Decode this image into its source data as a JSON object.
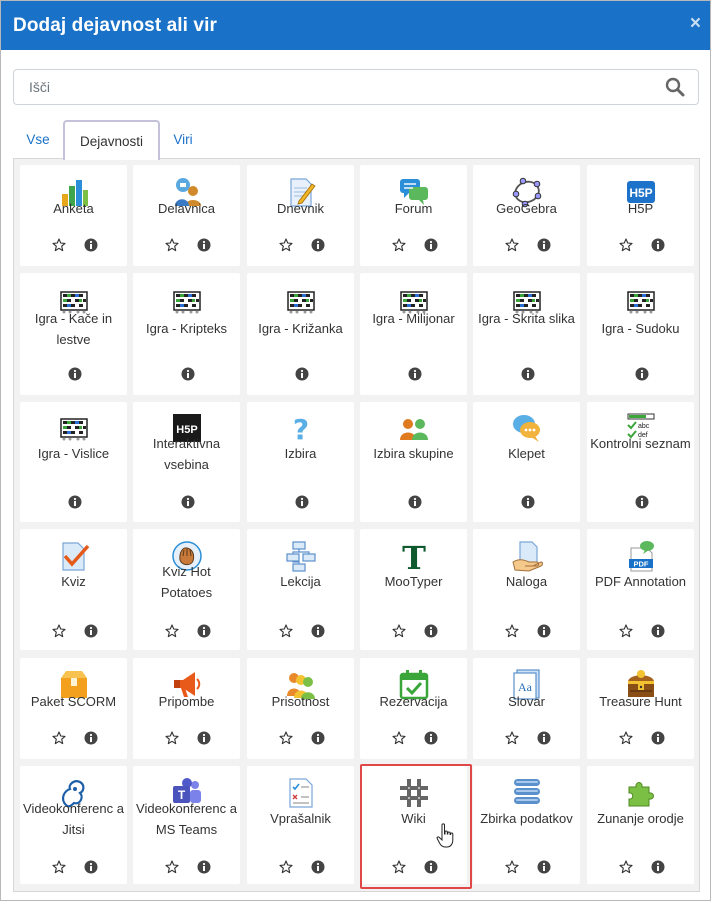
{
  "dialog": {
    "title": "Dodaj dejavnost ali vir",
    "close_glyph": "×"
  },
  "search": {
    "placeholder": "Išči",
    "value": ""
  },
  "tabs": [
    {
      "label": "Vse",
      "active": false
    },
    {
      "label": "Dejavnosti",
      "active": true
    },
    {
      "label": "Viri",
      "active": false
    }
  ],
  "tiles": [
    {
      "name": "Anketa",
      "icon": "bar-chart-icon"
    },
    {
      "name": "Delavnica",
      "icon": "workshop-icon"
    },
    {
      "name": "Dnevnik",
      "icon": "journal-icon"
    },
    {
      "name": "Forum",
      "icon": "forum-icon"
    },
    {
      "name": "GeoGebra",
      "icon": "geogebra-icon"
    },
    {
      "name": "H5P",
      "icon": "h5p-icon"
    },
    {
      "name": "Igra - Kače in lestve",
      "icon": "game-board-icon"
    },
    {
      "name": "Igra - Kripteks",
      "icon": "game-board-icon"
    },
    {
      "name": "Igra - Križanka",
      "icon": "game-board-icon"
    },
    {
      "name": "Igra - Milijonar",
      "icon": "game-board-icon"
    },
    {
      "name": "Igra - Skrita slika",
      "icon": "game-board-icon"
    },
    {
      "name": "Igra - Sudoku",
      "icon": "game-board-icon"
    },
    {
      "name": "Igra - Vislice",
      "icon": "game-board-icon"
    },
    {
      "name": "Interaktivna vsebina",
      "icon": "h5p-dark-icon"
    },
    {
      "name": "Izbira",
      "icon": "question-mark-icon"
    },
    {
      "name": "Izbira skupine",
      "icon": "group-choice-icon"
    },
    {
      "name": "Klepet",
      "icon": "chat-icon"
    },
    {
      "name": "Kontrolni seznam",
      "icon": "checklist-icon"
    },
    {
      "name": "Kviz",
      "icon": "quiz-icon"
    },
    {
      "name": "Kviz Hot Potatoes",
      "icon": "hot-potatoes-icon"
    },
    {
      "name": "Lekcija",
      "icon": "lesson-icon"
    },
    {
      "name": "MooTyper",
      "icon": "mootyper-icon"
    },
    {
      "name": "Naloga",
      "icon": "assignment-icon"
    },
    {
      "name": "PDF Annotation",
      "icon": "pdf-icon"
    },
    {
      "name": "Paket SCORM",
      "icon": "scorm-package-icon"
    },
    {
      "name": "Pripombe",
      "icon": "megaphone-icon"
    },
    {
      "name": "Prisotnost",
      "icon": "attendance-icon"
    },
    {
      "name": "Rezervacija",
      "icon": "calendar-check-icon"
    },
    {
      "name": "Slovar",
      "icon": "glossary-icon"
    },
    {
      "name": "Treasure Hunt",
      "icon": "treasure-chest-icon"
    },
    {
      "name": "Videokonferenc a Jitsi",
      "icon": "jitsi-icon"
    },
    {
      "name": "Videokonferenc a MS Teams",
      "icon": "ms-teams-icon"
    },
    {
      "name": "Vprašalnik",
      "icon": "questionnaire-icon"
    },
    {
      "name": "Wiki",
      "icon": "wiki-icon"
    },
    {
      "name": "Zbirka podatkov",
      "icon": "database-icon"
    },
    {
      "name": "Zunanje orodje",
      "icon": "puzzle-piece-icon"
    }
  ],
  "colors": {
    "header": "#1a72c8",
    "link": "#1a72c8",
    "highlight": "#e04848",
    "panel": "#f2f2f2"
  }
}
